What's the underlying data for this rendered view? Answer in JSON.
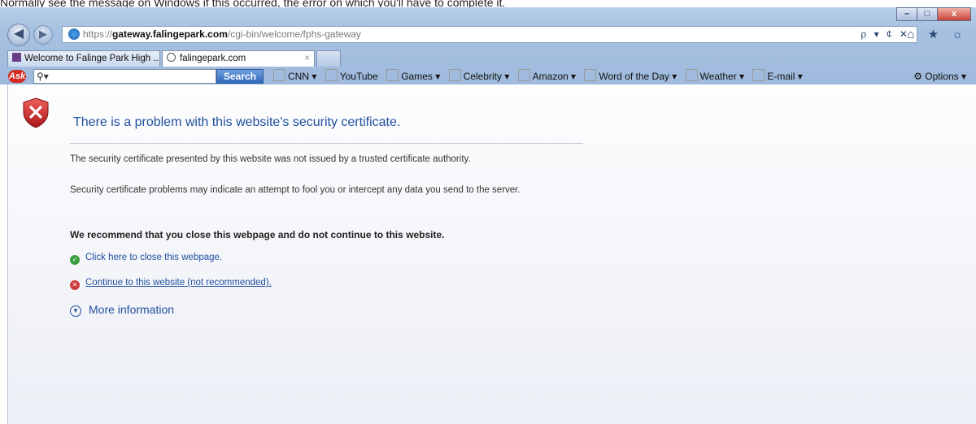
{
  "caption_fragment": "Normally see the message on Windows if this occurred, the error on which you'll have to complete it.",
  "window_controls": {
    "minimize": "–",
    "maximize": "□",
    "close": "x"
  },
  "address_bar": {
    "protocol": "https://",
    "domain": "gateway.falingepark.com",
    "path": "/cgi-bin/welcome/fphs-gateway",
    "tools": "ρ ▾ ¢ ✕"
  },
  "favorites_icons": "⌂ ★ ☼",
  "tabs": [
    {
      "label": "Welcome to Falinge Park High ...",
      "active": false
    },
    {
      "label": "falingepark.com",
      "active": true,
      "close": "×"
    }
  ],
  "toolbar": {
    "logo": "Ask",
    "search_placeholder": "",
    "search_button": "Search",
    "items": [
      "CNN ▾",
      "YouTube",
      "Games ▾",
      "Celebrity ▾",
      "Amazon ▾",
      "Word of the Day ▾",
      "Weather ▾",
      "E-mail ▾"
    ],
    "options": "Options ▾"
  },
  "page": {
    "title": "There is a problem with this website's security certificate.",
    "para1": "The security certificate presented by this website was not issued by a trusted certificate authority.",
    "para2": "Security certificate problems may indicate an attempt to fool you or intercept any data you send to the server.",
    "recommendation": "We recommend that you close this webpage and do not continue to this website.",
    "close_link": "Click here to close this webpage.",
    "continue_link": "Continue to this website (not recommended).",
    "more_info": "More information"
  },
  "colors": {
    "link": "#1f4f9e",
    "chrome": "#a6c1e1",
    "error_red": "#cf3b3b",
    "ok_green": "#3c9e42"
  }
}
